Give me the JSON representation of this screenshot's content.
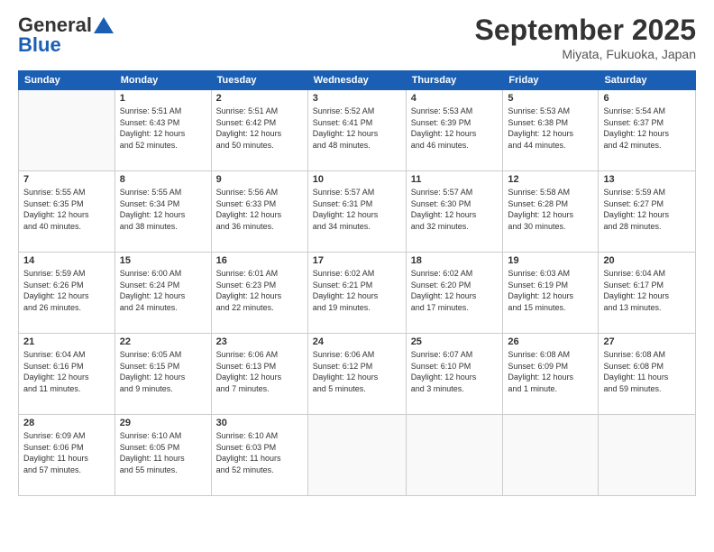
{
  "logo": {
    "general": "General",
    "blue": "Blue"
  },
  "header": {
    "month": "September 2025",
    "location": "Miyata, Fukuoka, Japan"
  },
  "weekdays": [
    "Sunday",
    "Monday",
    "Tuesday",
    "Wednesday",
    "Thursday",
    "Friday",
    "Saturday"
  ],
  "weeks": [
    [
      {
        "day": "",
        "info": ""
      },
      {
        "day": "1",
        "info": "Sunrise: 5:51 AM\nSunset: 6:43 PM\nDaylight: 12 hours\nand 52 minutes."
      },
      {
        "day": "2",
        "info": "Sunrise: 5:51 AM\nSunset: 6:42 PM\nDaylight: 12 hours\nand 50 minutes."
      },
      {
        "day": "3",
        "info": "Sunrise: 5:52 AM\nSunset: 6:41 PM\nDaylight: 12 hours\nand 48 minutes."
      },
      {
        "day": "4",
        "info": "Sunrise: 5:53 AM\nSunset: 6:39 PM\nDaylight: 12 hours\nand 46 minutes."
      },
      {
        "day": "5",
        "info": "Sunrise: 5:53 AM\nSunset: 6:38 PM\nDaylight: 12 hours\nand 44 minutes."
      },
      {
        "day": "6",
        "info": "Sunrise: 5:54 AM\nSunset: 6:37 PM\nDaylight: 12 hours\nand 42 minutes."
      }
    ],
    [
      {
        "day": "7",
        "info": "Sunrise: 5:55 AM\nSunset: 6:35 PM\nDaylight: 12 hours\nand 40 minutes."
      },
      {
        "day": "8",
        "info": "Sunrise: 5:55 AM\nSunset: 6:34 PM\nDaylight: 12 hours\nand 38 minutes."
      },
      {
        "day": "9",
        "info": "Sunrise: 5:56 AM\nSunset: 6:33 PM\nDaylight: 12 hours\nand 36 minutes."
      },
      {
        "day": "10",
        "info": "Sunrise: 5:57 AM\nSunset: 6:31 PM\nDaylight: 12 hours\nand 34 minutes."
      },
      {
        "day": "11",
        "info": "Sunrise: 5:57 AM\nSunset: 6:30 PM\nDaylight: 12 hours\nand 32 minutes."
      },
      {
        "day": "12",
        "info": "Sunrise: 5:58 AM\nSunset: 6:28 PM\nDaylight: 12 hours\nand 30 minutes."
      },
      {
        "day": "13",
        "info": "Sunrise: 5:59 AM\nSunset: 6:27 PM\nDaylight: 12 hours\nand 28 minutes."
      }
    ],
    [
      {
        "day": "14",
        "info": "Sunrise: 5:59 AM\nSunset: 6:26 PM\nDaylight: 12 hours\nand 26 minutes."
      },
      {
        "day": "15",
        "info": "Sunrise: 6:00 AM\nSunset: 6:24 PM\nDaylight: 12 hours\nand 24 minutes."
      },
      {
        "day": "16",
        "info": "Sunrise: 6:01 AM\nSunset: 6:23 PM\nDaylight: 12 hours\nand 22 minutes."
      },
      {
        "day": "17",
        "info": "Sunrise: 6:02 AM\nSunset: 6:21 PM\nDaylight: 12 hours\nand 19 minutes."
      },
      {
        "day": "18",
        "info": "Sunrise: 6:02 AM\nSunset: 6:20 PM\nDaylight: 12 hours\nand 17 minutes."
      },
      {
        "day": "19",
        "info": "Sunrise: 6:03 AM\nSunset: 6:19 PM\nDaylight: 12 hours\nand 15 minutes."
      },
      {
        "day": "20",
        "info": "Sunrise: 6:04 AM\nSunset: 6:17 PM\nDaylight: 12 hours\nand 13 minutes."
      }
    ],
    [
      {
        "day": "21",
        "info": "Sunrise: 6:04 AM\nSunset: 6:16 PM\nDaylight: 12 hours\nand 11 minutes."
      },
      {
        "day": "22",
        "info": "Sunrise: 6:05 AM\nSunset: 6:15 PM\nDaylight: 12 hours\nand 9 minutes."
      },
      {
        "day": "23",
        "info": "Sunrise: 6:06 AM\nSunset: 6:13 PM\nDaylight: 12 hours\nand 7 minutes."
      },
      {
        "day": "24",
        "info": "Sunrise: 6:06 AM\nSunset: 6:12 PM\nDaylight: 12 hours\nand 5 minutes."
      },
      {
        "day": "25",
        "info": "Sunrise: 6:07 AM\nSunset: 6:10 PM\nDaylight: 12 hours\nand 3 minutes."
      },
      {
        "day": "26",
        "info": "Sunrise: 6:08 AM\nSunset: 6:09 PM\nDaylight: 12 hours\nand 1 minute."
      },
      {
        "day": "27",
        "info": "Sunrise: 6:08 AM\nSunset: 6:08 PM\nDaylight: 11 hours\nand 59 minutes."
      }
    ],
    [
      {
        "day": "28",
        "info": "Sunrise: 6:09 AM\nSunset: 6:06 PM\nDaylight: 11 hours\nand 57 minutes."
      },
      {
        "day": "29",
        "info": "Sunrise: 6:10 AM\nSunset: 6:05 PM\nDaylight: 11 hours\nand 55 minutes."
      },
      {
        "day": "30",
        "info": "Sunrise: 6:10 AM\nSunset: 6:03 PM\nDaylight: 11 hours\nand 52 minutes."
      },
      {
        "day": "",
        "info": ""
      },
      {
        "day": "",
        "info": ""
      },
      {
        "day": "",
        "info": ""
      },
      {
        "day": "",
        "info": ""
      }
    ]
  ]
}
